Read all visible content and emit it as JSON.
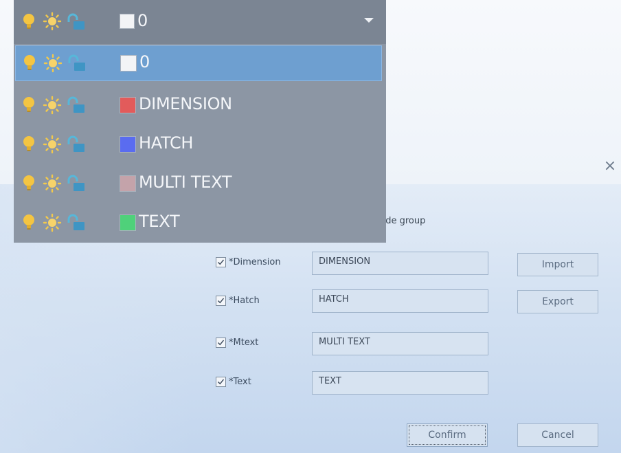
{
  "layer_dropdown": {
    "current": {
      "name": "0",
      "color": "#f3f4f6"
    },
    "layers": [
      {
        "name": "0",
        "color": "#f3f4f6",
        "selected": true
      },
      {
        "name": "DIMENSION",
        "color": "#e25b5b",
        "selected": false
      },
      {
        "name": "HATCH",
        "color": "#5a6cf0",
        "selected": false
      },
      {
        "name": "MULTI TEXT",
        "color": "#c4a3aa",
        "selected": false
      },
      {
        "name": "TEXT",
        "color": "#4fd17a",
        "selected": false
      }
    ],
    "icons": [
      "lightbulb-icon",
      "sun-icon",
      "unlock-icon"
    ]
  },
  "dialog": {
    "close_label": "×",
    "group_label_partial": "ude group",
    "rows": [
      {
        "label": "*Dimension",
        "checked": true,
        "value": "DIMENSION"
      },
      {
        "label": "*Hatch",
        "checked": true,
        "value": "HATCH"
      },
      {
        "label": "*Mtext",
        "checked": true,
        "value": "MULTI TEXT"
      },
      {
        "label": "*Text",
        "checked": true,
        "value": "TEXT"
      }
    ],
    "buttons": {
      "import": "Import",
      "export": "Export",
      "confirm": "Confirm",
      "cancel": "Cancel"
    }
  }
}
